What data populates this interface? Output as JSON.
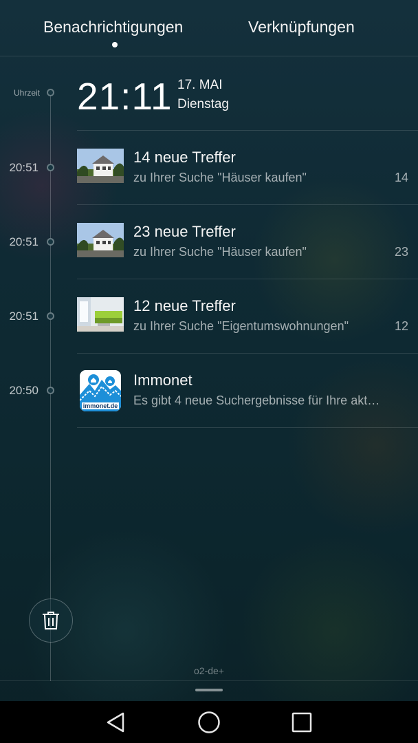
{
  "tabs": {
    "notifications": "Benachrichtigungen",
    "shortcuts": "Verknüpfungen",
    "active": "notifications"
  },
  "clock": {
    "label": "Uhrzeit",
    "time": "21:11",
    "date": "17. MAI",
    "weekday": "Dienstag"
  },
  "notifications": [
    {
      "time": "20:51",
      "title": "14 neue Treffer",
      "subtitle": "zu Ihrer Suche \"Häuser kaufen\"",
      "count": "14",
      "icon": "house-photo-thumbnail"
    },
    {
      "time": "20:51",
      "title": "23 neue Treffer",
      "subtitle": "zu Ihrer Suche \"Häuser kaufen\"",
      "count": "23",
      "icon": "house-photo-thumbnail"
    },
    {
      "time": "20:51",
      "title": "12 neue Treffer",
      "subtitle": "zu Ihrer Suche \"Eigentumswohnungen\"",
      "count": "12",
      "icon": "apartment-photo-thumbnail"
    },
    {
      "time": "20:50",
      "title": "Immonet",
      "subtitle": "Es gibt 4 neue Suchergebnisse für Ihre akt…",
      "count": "",
      "icon": "immonet-app-icon",
      "icon_text": "immonet.de"
    }
  ],
  "footer": {
    "carrier": "o2-de+"
  },
  "navbar": {
    "icons": [
      "back-icon",
      "home-icon",
      "recent-apps-icon"
    ]
  },
  "colors": {
    "immonet_blue": "#1d8fd8",
    "background": "#0e2a36"
  }
}
